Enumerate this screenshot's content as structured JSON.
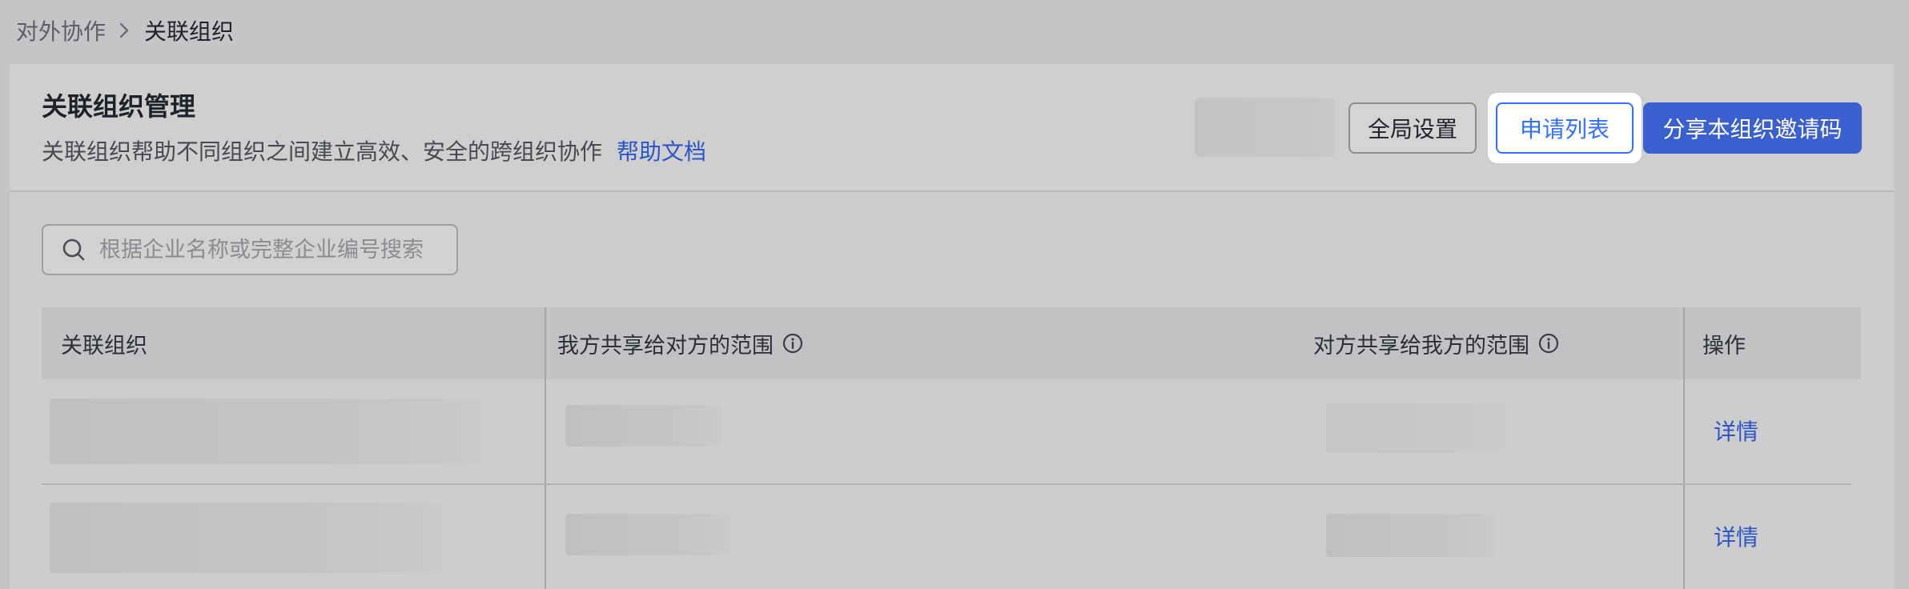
{
  "breadcrumb": {
    "parent": "对外协作",
    "current": "关联组织"
  },
  "header": {
    "title": "关联组织管理",
    "description": "关联组织帮助不同组织之间建立高效、安全的跨组织协作",
    "help_link": "帮助文档"
  },
  "toolbar": {
    "global_settings_label": "全局设置",
    "apply_list_label": "申请列表",
    "share_invite_label": "分享本组织邀请码"
  },
  "search": {
    "placeholder": "根据企业名称或完整企业编号搜索",
    "value": ""
  },
  "table": {
    "columns": [
      {
        "label": "关联组织",
        "info_icon": false
      },
      {
        "label": "我方共享给对方的范围",
        "info_icon": true
      },
      {
        "label": "对方共享给我方的范围",
        "info_icon": true
      },
      {
        "label": "操作",
        "info_icon": false
      }
    ],
    "rows": [
      {
        "action": "详情"
      },
      {
        "action": "详情"
      }
    ]
  },
  "icons": {
    "chevron": "chevron-right-icon",
    "search": "search-icon",
    "info": "info-icon"
  },
  "colors": {
    "accent": "#3370ff",
    "primary_button": "#3a5fcf",
    "link": "#2d55c8"
  }
}
